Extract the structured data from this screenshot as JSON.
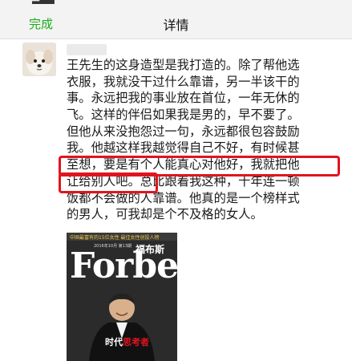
{
  "nav": {
    "done_label": "完成",
    "title": "详情"
  },
  "post": {
    "lines": [
      "王先生的这身造型是我打造的。除了帮他选",
      "衣服，我就没干过什么靠谱，另一半该干的",
      "事。永远把我的事业放在首位，一年无休的",
      "飞。这样的伴侣如果我是男的，早不要了。",
      "但他从来没抱怨过一句，永远都很包容鼓励",
      "我。他越这样我越觉得自己不好，有时候甚",
      "至想，要是有个人能真心对他好，我就把他",
      "让给别人吧。总比跟着我这种，十年连一顿",
      "饭都不会做的人靠谱。他真的是一个榜样式",
      "的男人，可我却是个不及格的女人。"
    ]
  },
  "magazine": {
    "tagline": "中国最富有的15位女性  最佳女性创投人榜",
    "date": "2016年10月 第13期",
    "logo": "Forbes",
    "cn_title": "福布斯",
    "headline_prefix": "时代",
    "headline_accent": "思考者"
  },
  "colors": {
    "accent_green": "#1aad19",
    "highlight_red": "#e0141f"
  }
}
